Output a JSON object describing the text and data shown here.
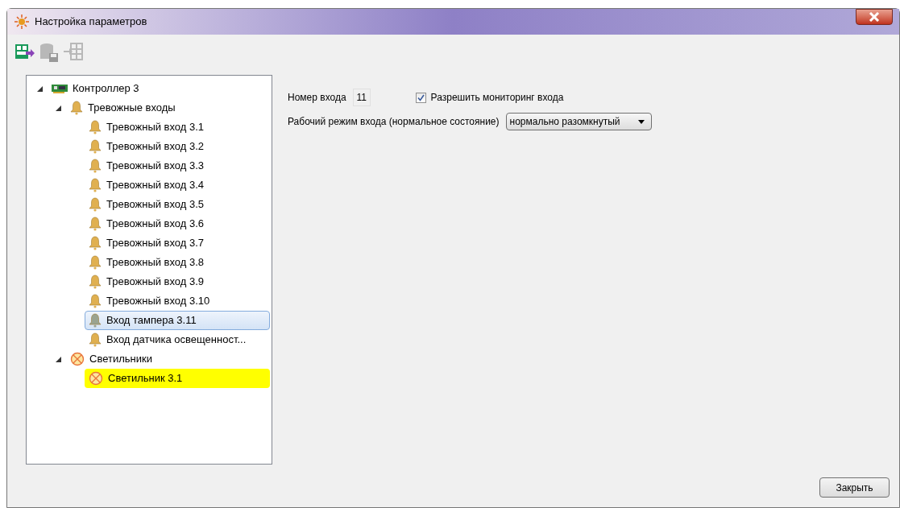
{
  "window": {
    "title": "Настройка параметров"
  },
  "toolbar": [
    {
      "kind": "upload",
      "disabled": false
    },
    {
      "kind": "save",
      "disabled": true
    },
    {
      "kind": "import",
      "disabled": true
    }
  ],
  "tree": [
    {
      "label": "Контроллер 3",
      "kind": "controller",
      "expanded": true,
      "selected": false,
      "highlighted": false,
      "children": [
        {
          "label": "Тревожные входы",
          "kind": "bell",
          "expanded": true,
          "selected": false,
          "highlighted": false,
          "children": [
            {
              "label": "Тревожный вход 3.1",
              "kind": "bell",
              "selected": false,
              "highlighted": false
            },
            {
              "label": "Тревожный вход 3.2",
              "kind": "bell",
              "selected": false,
              "highlighted": false
            },
            {
              "label": "Тревожный вход 3.3",
              "kind": "bell",
              "selected": false,
              "highlighted": false
            },
            {
              "label": "Тревожный вход 3.4",
              "kind": "bell",
              "selected": false,
              "highlighted": false
            },
            {
              "label": "Тревожный вход 3.5",
              "kind": "bell",
              "selected": false,
              "highlighted": false
            },
            {
              "label": "Тревожный вход 3.6",
              "kind": "bell",
              "selected": false,
              "highlighted": false
            },
            {
              "label": "Тревожный вход 3.7",
              "kind": "bell",
              "selected": false,
              "highlighted": false
            },
            {
              "label": "Тревожный вход 3.8",
              "kind": "bell",
              "selected": false,
              "highlighted": false
            },
            {
              "label": "Тревожный вход 3.9",
              "kind": "bell",
              "selected": false,
              "highlighted": false
            },
            {
              "label": "Тревожный вход 3.10",
              "kind": "bell",
              "selected": false,
              "highlighted": false
            },
            {
              "label": "Вход тампера 3.11",
              "kind": "bell-grey",
              "selected": true,
              "highlighted": false
            },
            {
              "label": "Вход датчика освещенност...",
              "kind": "bell",
              "selected": false,
              "highlighted": false
            }
          ]
        },
        {
          "label": "Светильники",
          "kind": "lamp",
          "expanded": true,
          "selected": false,
          "highlighted": false,
          "children": [
            {
              "label": "Светильник 3.1",
              "kind": "lamp",
              "selected": false,
              "highlighted": true
            }
          ]
        }
      ]
    }
  ],
  "form": {
    "input_number_label": "Номер входа",
    "input_number": "11",
    "monitoring_label": "Разрешить мониторинг входа",
    "monitoring_checked": true,
    "mode_label": "Рабочий режим входа (нормальное состояние)",
    "mode_value": "нормально разомкнутый"
  },
  "buttons": {
    "close": "Закрыть"
  }
}
